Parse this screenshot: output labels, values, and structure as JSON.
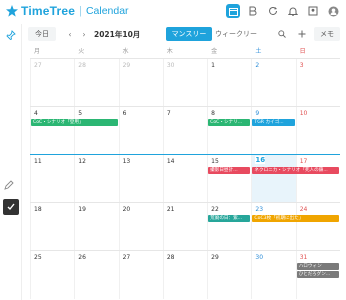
{
  "header": {
    "brand": "TimeTree",
    "separator": "|",
    "subtitle": "Calendar",
    "icons": [
      "calendar-icon",
      "b-icon",
      "sync-icon",
      "bell-icon",
      "user-icon",
      "account-icon"
    ]
  },
  "toolbar": {
    "today_label": "今日",
    "prev": "‹",
    "next": "›",
    "month_label": "2021年10月",
    "month_view_label": "マンスリー",
    "week_view_label": "ウィークリー",
    "memo_label": "メモ"
  },
  "weekdays": [
    "月",
    "火",
    "水",
    "木",
    "金",
    "土",
    "日"
  ],
  "weeks": [
    {
      "days": [
        "27",
        "28",
        "29",
        "30",
        "1",
        "2",
        "3"
      ],
      "other": [
        true,
        true,
        true,
        true,
        false,
        false,
        false
      ]
    },
    {
      "days": [
        "4",
        "5",
        "6",
        "7",
        "8",
        "9",
        "10"
      ],
      "other": [
        false,
        false,
        false,
        false,
        false,
        false,
        false
      ]
    },
    {
      "days": [
        "11",
        "12",
        "13",
        "14",
        "15",
        "16",
        "17"
      ],
      "other": [
        false,
        false,
        false,
        false,
        false,
        false,
        false
      ]
    },
    {
      "days": [
        "18",
        "19",
        "20",
        "21",
        "22",
        "23",
        "24"
      ],
      "other": [
        false,
        false,
        false,
        false,
        false,
        false,
        false
      ]
    },
    {
      "days": [
        "25",
        "26",
        "27",
        "28",
        "29",
        "30",
        "31"
      ],
      "other": [
        false,
        false,
        false,
        false,
        false,
        false,
        false
      ]
    }
  ],
  "events": [
    {
      "label": "CoC・シナリオ「登用」",
      "color": "#2bb673"
    },
    {
      "label": "CoC・シナリ...",
      "color": "#2bb673"
    },
    {
      "label": "TGR カイゴ...",
      "color": "#1fa3dc"
    },
    {
      "label": "撮影日昼計…",
      "color": "#e84a5f"
    },
    {
      "label": "ネクロニカ・シナリオ「死人の鎖...",
      "color": "#e84a5f"
    },
    {
      "label": "荒廃の日：紫...",
      "color": "#26a69a"
    },
    {
      "label": "CoC3枚「初期に出た」",
      "color": "#f0a500"
    },
    {
      "label": "ハロウィン",
      "color": "#7a7a7a"
    },
    {
      "label": "ひとだろグン...",
      "color": "#7a7a7a"
    }
  ],
  "colors": {
    "accent": "#1fa3dc",
    "sunday": "#e05050",
    "saturday": "#2a8cd8"
  }
}
